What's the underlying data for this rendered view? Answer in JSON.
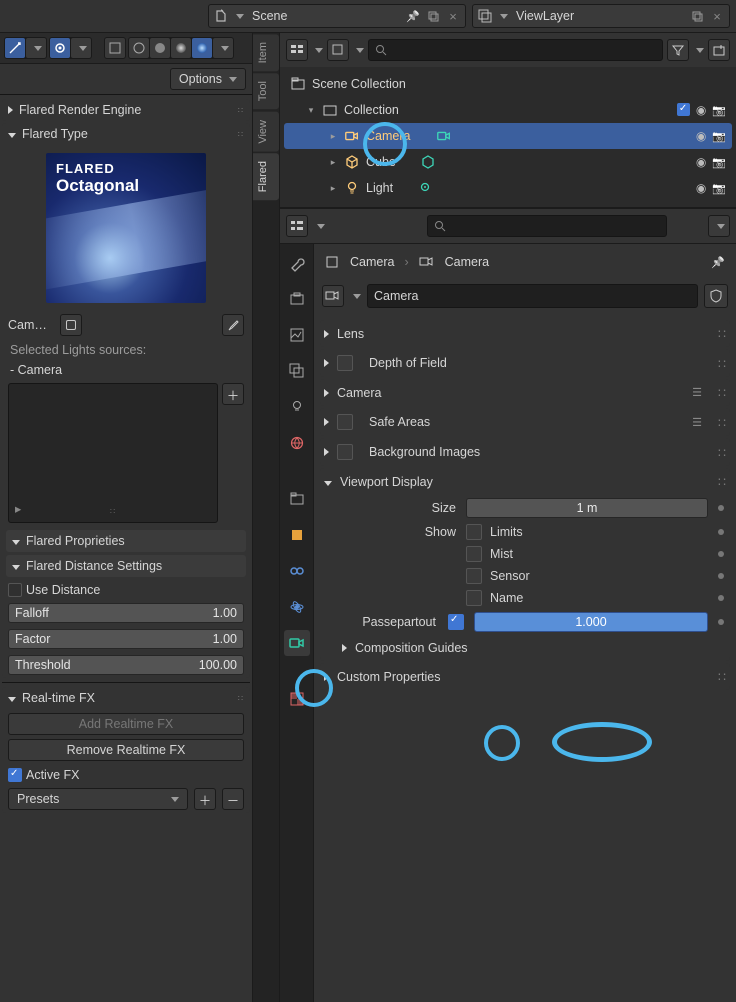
{
  "top": {
    "scene_label": "Scene",
    "layer_label": "ViewLayer"
  },
  "left": {
    "options_label": "Options",
    "panels": {
      "render": "Flared Render Engine",
      "type": "Flared Type",
      "cam": "Cam…",
      "selected": "Selected Lights sources:",
      "selected_item": "- Camera",
      "propr": "Flared Proprieties",
      "dist": "Flared Distance Settings",
      "use_dist": "Use Distance",
      "falloff_l": "Falloff",
      "falloff_v": "1.00",
      "factor_l": "Factor",
      "factor_v": "1.00",
      "thresh_l": "Threshold",
      "thresh_v": "100.00",
      "rtfx": "Real-time FX",
      "add_fx": "Add Realtime FX",
      "rem_fx": "Remove Realtime FX",
      "active_fx": "Active FX",
      "presets": "Presets"
    },
    "thumb": {
      "line1": "FLARED",
      "line2": "Octagonal"
    }
  },
  "vside": [
    "Item",
    "Tool",
    "View",
    "Flared"
  ],
  "outliner": {
    "root": "Scene Collection",
    "coll": "Collection",
    "items": [
      {
        "name": "Camera",
        "sel": true
      },
      {
        "name": "Cube",
        "sel": false
      },
      {
        "name": "Light",
        "sel": false
      }
    ]
  },
  "crumb": {
    "a": "Camera",
    "b": "Camera"
  },
  "cam_name": "Camera",
  "props": {
    "lens": "Lens",
    "dof": "Depth of Field",
    "camera": "Camera",
    "safe": "Safe Areas",
    "bg": "Background Images",
    "vp": "Viewport Display",
    "size_l": "Size",
    "size_v": "1 m",
    "show_l": "Show",
    "limits": "Limits",
    "mist": "Mist",
    "sensor": "Sensor",
    "name": "Name",
    "pass_l": "Passepartout",
    "pass_v": "1.000",
    "comp": "Composition Guides",
    "custom": "Custom Properties"
  }
}
